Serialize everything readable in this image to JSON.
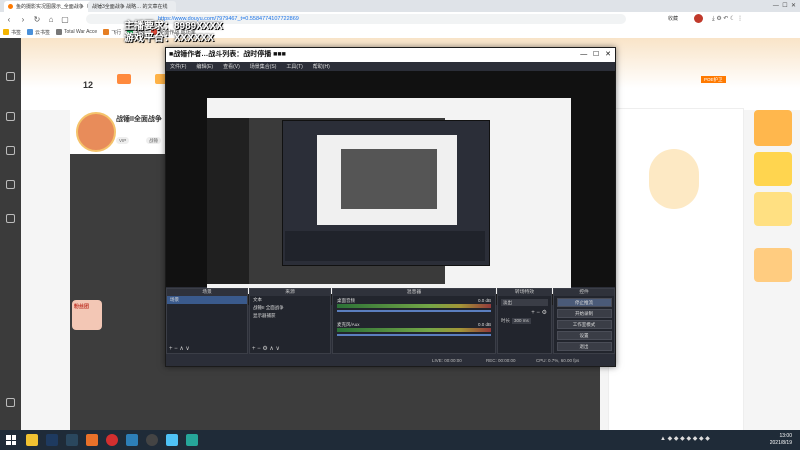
{
  "browser": {
    "tabs": [
      {
        "label": "鱼的摄影实况图展示_全面战争（"
      },
      {
        "label": "战锤3全面战争 战略… 的文章在线"
      }
    ],
    "url": "https://www.douyu.com/7979467_t=0.5584774107722869",
    "bookmarks": [
      "书签",
      "云书签",
      "Total War Acce",
      "飞行",
      "发现",
      "全面作战 成功率"
    ],
    "toolbar_right": [
      "收藏",
      "历史"
    ]
  },
  "room": {
    "title": "战锤II全面战争",
    "tags": [
      "VIP",
      "战锤"
    ],
    "level_number": "12",
    "right_badges": [
      "POE护卫",
      "赛事"
    ],
    "fans_label": "粉丝团"
  },
  "overlay": {
    "line1": "主播要求：8989XXXX",
    "line2": "游戏平台：XXXXXX",
    "obs_title": "■战锤作者…战斗列表：战时停播 ■ ■ ■"
  },
  "obs": {
    "window_title": "■战锤作者…战斗列表：战时停播 ■■■",
    "menu": [
      "文件(F)",
      "编辑(E)",
      "查看(V)",
      "场景集合(S)",
      "工具(T)",
      "帮助(H)"
    ],
    "panels": {
      "scenes": {
        "header": "场景",
        "items": [
          "场景"
        ]
      },
      "sources": {
        "header": "来源",
        "items": [
          "文本",
          "战锤II 全面战争",
          "显示器捕获"
        ]
      },
      "mixer": {
        "header": "混音器",
        "channels": [
          {
            "name": "桌面音频",
            "db": "0.0 dB"
          },
          {
            "name": "麦克风/Aux",
            "db": "0.0 dB"
          }
        ]
      },
      "transitions": {
        "header": "转场特效",
        "type": "淡出",
        "duration_label": "时长",
        "duration": "300 ms"
      },
      "controls": {
        "header": "控件",
        "buttons": [
          "停止推流",
          "开始录制",
          "工作室模式",
          "设置",
          "退出"
        ]
      }
    },
    "status": {
      "live": "LIVE: 00:00:00",
      "rec": "REC: 00:00:00",
      "cpu": "CPU: 0.7%, 60.00 fps"
    }
  },
  "taskbar": {
    "time": "13:00",
    "date": "2021/8/19"
  },
  "colors": {
    "accent": "#ff7a00",
    "obs_bg": "#2b2e38",
    "taskbar": "#1f2b38"
  }
}
